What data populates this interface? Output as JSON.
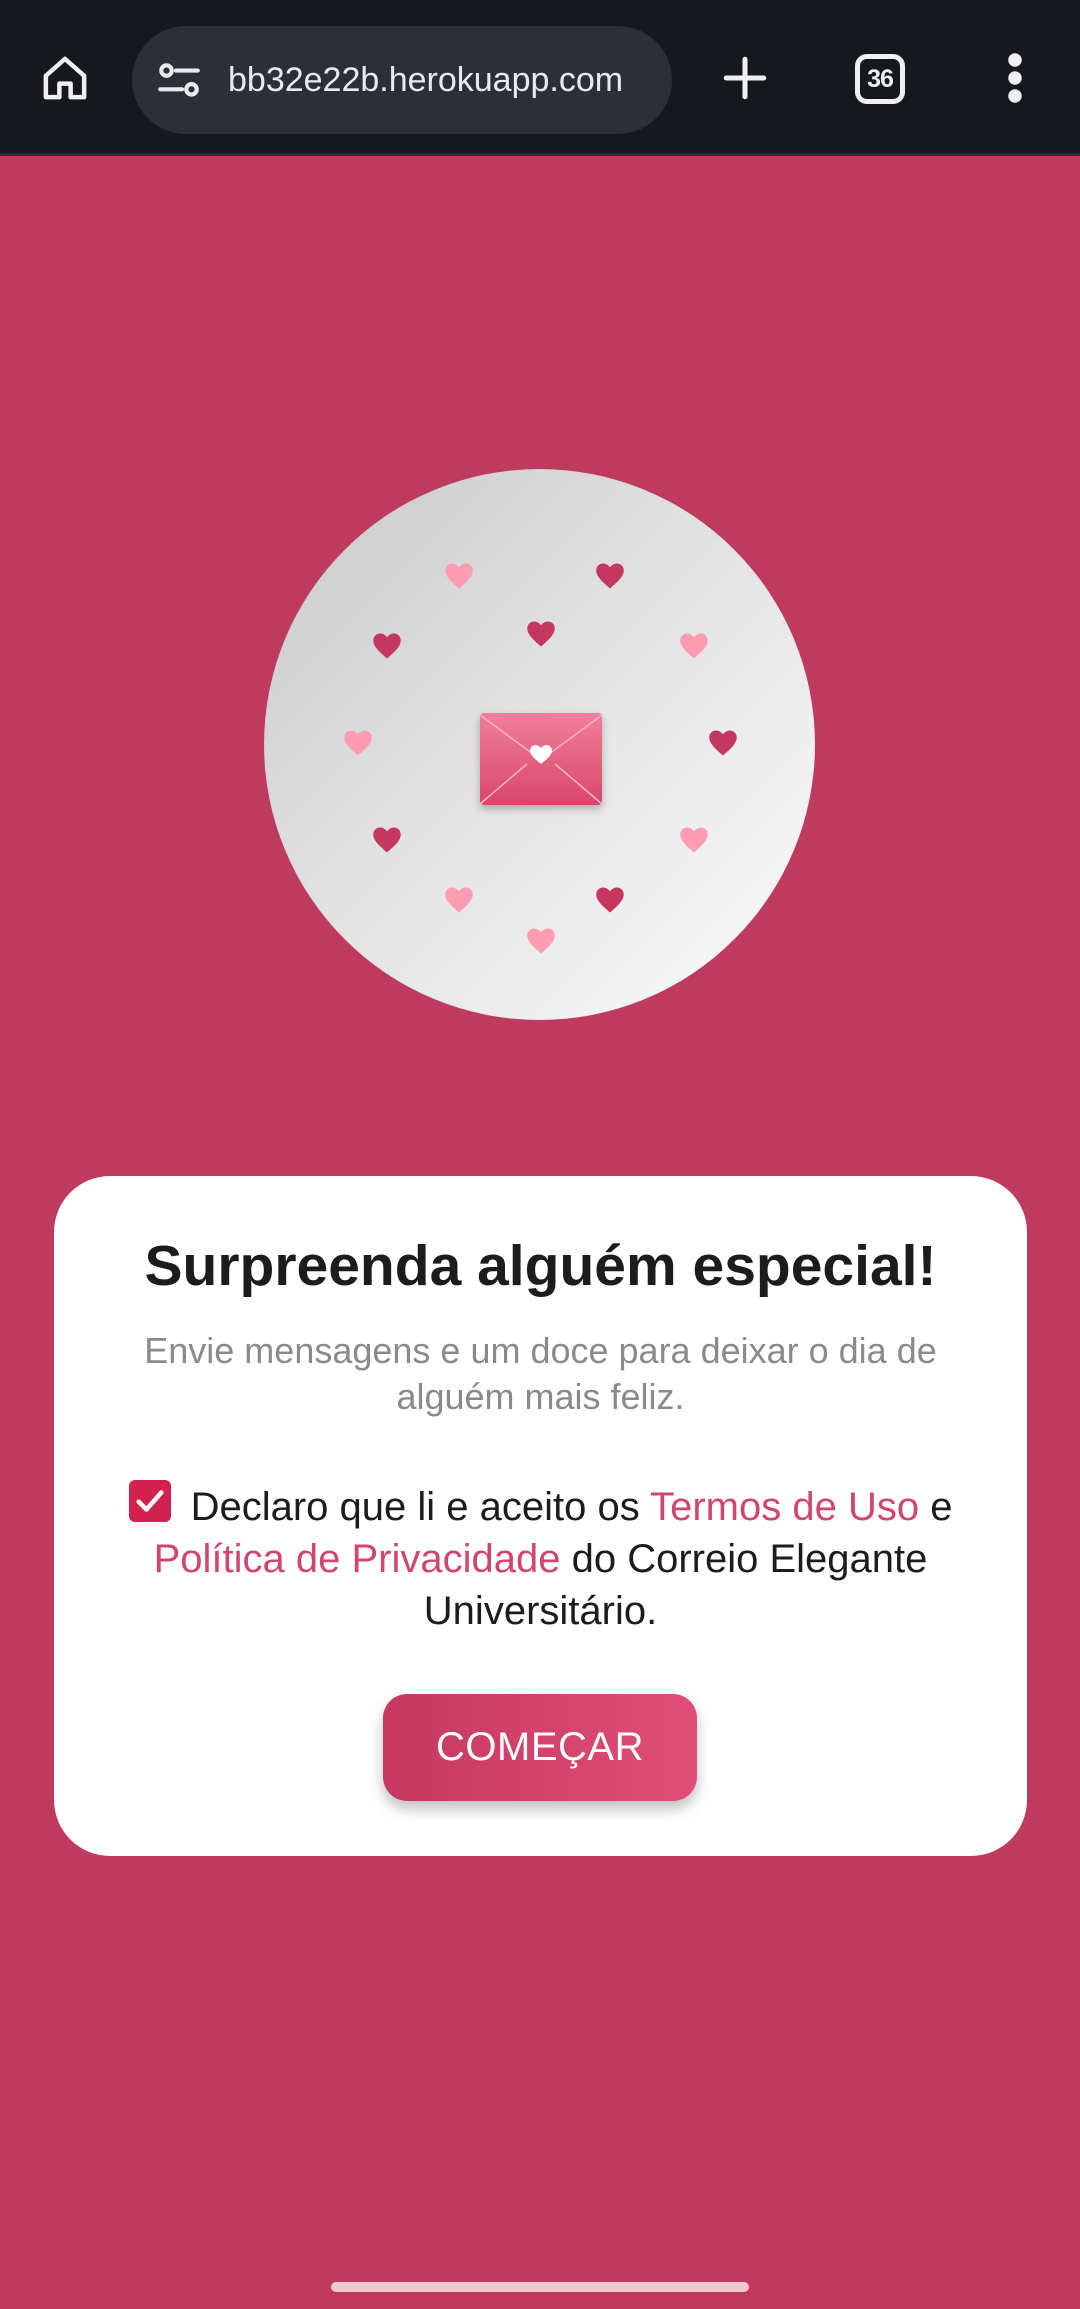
{
  "browser": {
    "url": "bb32e22b.herokuapp.com",
    "tab_count": "36",
    "icons": {
      "home": "home-icon",
      "site_settings": "tune-icon",
      "new_tab": "plus-icon",
      "menu": "more-vert-icon"
    }
  },
  "hero": {
    "icon": "envelope-heart-icon",
    "decor": "hearts-ring",
    "heart_colors": {
      "dark": "#c6375f",
      "light": "#ff9cb3"
    }
  },
  "card": {
    "title": "Surpreenda alguém especial!",
    "subtitle": "Envie mensagens e um doce para deixar o dia de alguém mais feliz.",
    "consent": {
      "checked": true,
      "text_before": "Declaro que li e aceito os ",
      "terms_link": "Termos de Uso",
      "text_mid": " e ",
      "privacy_link": "Política de Privacidade",
      "text_after": " do Correio Elegante Universitário."
    },
    "start_button": "COMEÇAR"
  },
  "colors": {
    "background": "#be3a5e",
    "accent": "#d3214f",
    "link": "#d1466f",
    "browser_bar": "#15181d"
  }
}
